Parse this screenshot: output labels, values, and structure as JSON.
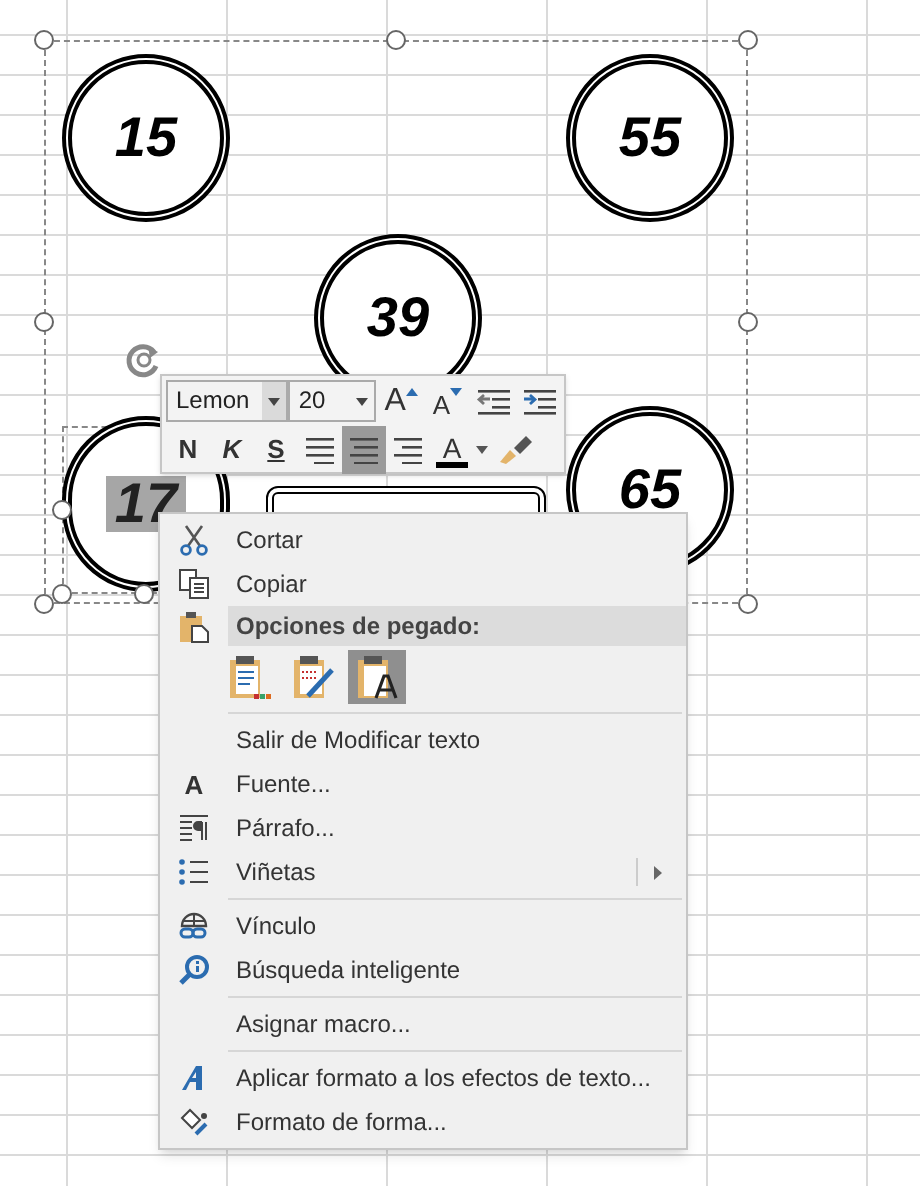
{
  "shapes": [
    {
      "kind": "circle",
      "label": "15",
      "highlighted": false
    },
    {
      "kind": "circle",
      "label": "55",
      "highlighted": false
    },
    {
      "kind": "circle",
      "label": "39",
      "highlighted": false
    },
    {
      "kind": "circle",
      "label": "17",
      "highlighted": true
    },
    {
      "kind": "circle",
      "label": "65",
      "highlighted": false
    },
    {
      "kind": "box"
    }
  ],
  "mini_toolbar": {
    "font": "Lemon",
    "size": "20",
    "row1": [
      {
        "kind": "grow",
        "label": "A"
      },
      {
        "kind": "shrink",
        "label": "A"
      },
      {
        "kind": "outdent"
      },
      {
        "kind": "indent"
      }
    ],
    "row2": [
      {
        "kind": "bold",
        "label": "N",
        "selected": false
      },
      {
        "kind": "italic",
        "label": "K",
        "selected": false
      },
      {
        "kind": "underline",
        "label": "S",
        "selected": false
      },
      {
        "kind": "left",
        "selected": false
      },
      {
        "kind": "center",
        "selected": true
      },
      {
        "kind": "right",
        "selected": false
      },
      {
        "kind": "color",
        "label": "A",
        "selected": false
      },
      {
        "kind": "painter",
        "selected": false
      }
    ]
  },
  "context_menu": [
    {
      "kind": "cut",
      "label": "Cortar",
      "submenu": false
    },
    {
      "kind": "copy",
      "label": "Copiar",
      "submenu": false
    },
    {
      "kind": "header",
      "label": "Opciones de pegado:"
    },
    {
      "kind": "paste",
      "options": [
        {
          "kind": "keep",
          "selected": false
        },
        {
          "kind": "merge",
          "selected": false
        },
        {
          "kind": "text",
          "selected": true
        }
      ]
    },
    {
      "kind": "separator"
    },
    {
      "kind": "plain",
      "label": "Salir de Modificar texto",
      "submenu": false
    },
    {
      "kind": "font",
      "icon_text": "A",
      "label": "Fuente...",
      "submenu": false
    },
    {
      "kind": "paragraph",
      "label": "Párrafo...",
      "submenu": false
    },
    {
      "kind": "bullets",
      "label": "Viñetas",
      "submenu": true
    },
    {
      "kind": "separator"
    },
    {
      "kind": "link",
      "label": "Vínculo",
      "submenu": false
    },
    {
      "kind": "lookup",
      "label": "Búsqueda inteligente",
      "submenu": false
    },
    {
      "kind": "separator"
    },
    {
      "kind": "plain",
      "label": "Asignar macro...",
      "submenu": false
    },
    {
      "kind": "separator"
    },
    {
      "kind": "effects",
      "label": "Aplicar formato a los efectos de texto...",
      "submenu": false
    },
    {
      "kind": "shape",
      "label": "Formato de forma...",
      "submenu": false
    }
  ]
}
